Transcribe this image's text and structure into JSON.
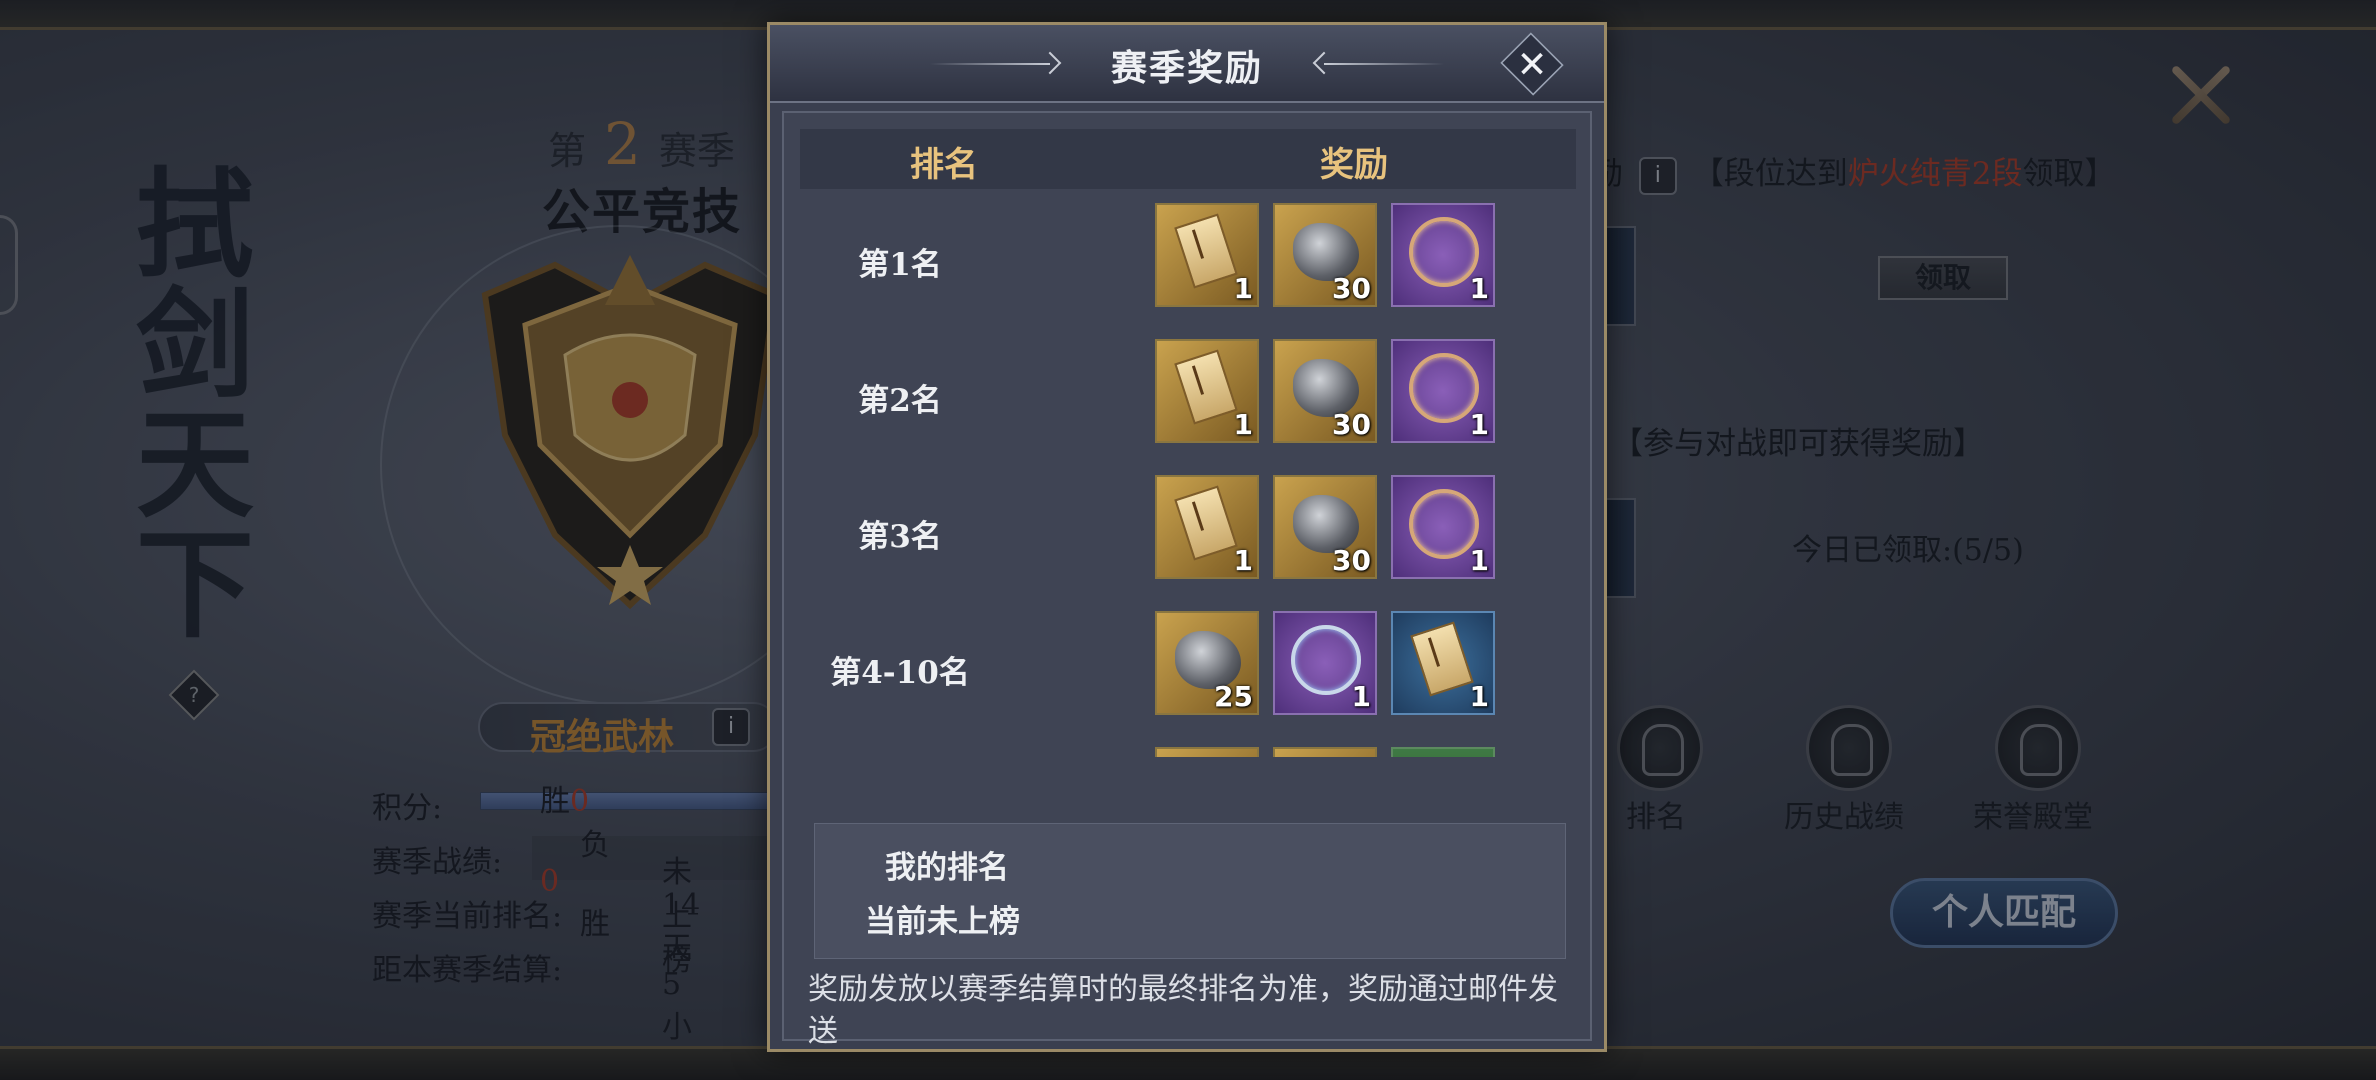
{
  "background": {
    "calligraphy": [
      "拭",
      "剑",
      "天",
      "下"
    ],
    "help_symbol": "?",
    "season": {
      "prefix": "第",
      "number": "2",
      "suffix": "赛季"
    },
    "mode_title": "公平竞技",
    "rank_title": "冠绝武林",
    "info_symbol": "i",
    "stats": {
      "score_label": "积分:",
      "record_label": "赛季战绩:",
      "win_label": "胜",
      "win_value": "0",
      "loss_label": "负",
      "loss_value": "0",
      "rate_label_partial": "胜",
      "current_rank_label": "赛季当前排名:",
      "current_rank_value": "未上榜",
      "settle_label": "距本赛季结算:",
      "settle_value_partial": "14天5小"
    },
    "claim": {
      "prefix_partial": "励",
      "open_bracket": "【段位达到",
      "highlight": "炉火纯青2段",
      "suffix": "领取】",
      "button": "领取"
    },
    "join_reward": "【参与对战即可获得奖励】",
    "today_claimed": "今日已领取:(5/5)",
    "nav": [
      "排名",
      "历史战绩",
      "荣誉殿堂"
    ],
    "match_button": "个人匹配",
    "close_icon": "close-icon"
  },
  "modal": {
    "title": "赛季奖励",
    "close_symbol": "✕",
    "table_headers": {
      "rank": "排名",
      "reward": "奖励"
    },
    "rows": [
      {
        "rank": "第1名",
        "items": [
          {
            "type": "scroll",
            "style": "gold",
            "count": "1"
          },
          {
            "type": "ore",
            "style": "gold",
            "count": "30"
          },
          {
            "type": "ring",
            "style": "purple",
            "count": "1"
          }
        ]
      },
      {
        "rank": "第2名",
        "items": [
          {
            "type": "scroll",
            "style": "gold",
            "count": "1"
          },
          {
            "type": "ore",
            "style": "gold",
            "count": "30"
          },
          {
            "type": "ring",
            "style": "purple",
            "count": "1"
          }
        ]
      },
      {
        "rank": "第3名",
        "items": [
          {
            "type": "scroll",
            "style": "gold",
            "count": "1"
          },
          {
            "type": "ore",
            "style": "gold",
            "count": "30"
          },
          {
            "type": "ring",
            "style": "purple",
            "count": "1"
          }
        ]
      },
      {
        "rank": "第4-10名",
        "items": [
          {
            "type": "ore",
            "style": "gold",
            "count": "25"
          },
          {
            "type": "ring",
            "style": "purple",
            "count": "1"
          },
          {
            "type": "scroll",
            "style": "blue",
            "count": "1"
          }
        ]
      }
    ],
    "my_rank": {
      "title": "我的排名",
      "value": "当前未上榜"
    },
    "note": "奖励发放以赛季结算时的最终排名为准，奖励通过邮件发送"
  },
  "colors": {
    "accent_gold": "#e8c37e",
    "highlight_red": "#b3402b",
    "rank_gold": "#c48a3a"
  }
}
